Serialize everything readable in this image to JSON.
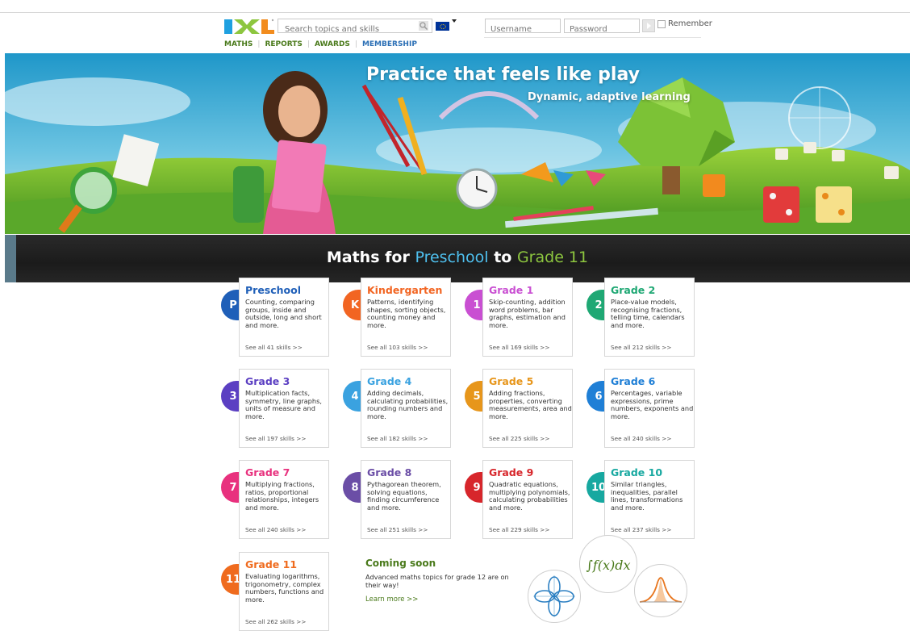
{
  "header": {
    "logo_text": "IXL",
    "search_placeholder": "Search topics and skills",
    "username_placeholder": "Username",
    "password_placeholder": "Password",
    "remember_label": "Remember",
    "nav": [
      {
        "label": "MATHS"
      },
      {
        "label": "REPORTS"
      },
      {
        "label": "AWARDS"
      },
      {
        "label": "MEMBERSHIP"
      }
    ]
  },
  "banner": {
    "title": "Practice that feels like play",
    "subtitle": "Dynamic, adaptive learning"
  },
  "strip": {
    "part1": "Maths for ",
    "preschool": "Preschool",
    "part2": " to ",
    "grade": "Grade 11"
  },
  "grades": [
    {
      "badge": "P",
      "name": "Preschool",
      "color": "#1f5fb8",
      "desc": "Counting, comparing groups, inside and outside, long and short and more.",
      "see": "See all 41 skills >>"
    },
    {
      "badge": "K",
      "name": "Kindergarten",
      "color": "#f26522",
      "desc": "Patterns, identifying shapes, sorting objects, counting money and more.",
      "see": "See all 103 skills >>"
    },
    {
      "badge": "1",
      "name": "Grade 1",
      "color": "#c94fd2",
      "desc": "Skip-counting, addition word problems, bar graphs, estimation and more.",
      "see": "See all 169 skills >>"
    },
    {
      "badge": "2",
      "name": "Grade 2",
      "color": "#1fa874",
      "desc": "Place-value models, recognising fractions, telling time, calendars and more.",
      "see": "See all 212 skills >>"
    },
    {
      "badge": "3",
      "name": "Grade 3",
      "color": "#5b3fc2",
      "desc": "Multiplication facts, symmetry, line graphs, units of measure and more.",
      "see": "See all 197 skills >>"
    },
    {
      "badge": "4",
      "name": "Grade 4",
      "color": "#3aa2e0",
      "desc": "Adding decimals, calculating probabilities, rounding numbers and more.",
      "see": "See all 182 skills >>"
    },
    {
      "badge": "5",
      "name": "Grade 5",
      "color": "#e7961b",
      "desc": "Adding fractions, properties, converting measurements, area and more.",
      "see": "See all 225 skills >>"
    },
    {
      "badge": "6",
      "name": "Grade 6",
      "color": "#1f7fd6",
      "desc": "Percentages, variable expressions, prime numbers, exponents and more.",
      "see": "See all 240 skills >>"
    },
    {
      "badge": "7",
      "name": "Grade 7",
      "color": "#e8317e",
      "desc": "Multiplying fractions, ratios, proportional relationships, integers and more.",
      "see": "See all 240 skills >>"
    },
    {
      "badge": "8",
      "name": "Grade 8",
      "color": "#6b4ea6",
      "desc": "Pythagorean theorem, solving equations, finding circumference and more.",
      "see": "See all 251 skills >>"
    },
    {
      "badge": "9",
      "name": "Grade 9",
      "color": "#d7262b",
      "desc": "Quadratic equations, multiplying polynomials, calculating probabilities and more.",
      "see": "See all 229 skills >>"
    },
    {
      "badge": "10",
      "name": "Grade 10",
      "color": "#17a8a0",
      "desc": "Similar triangles, inequalities, parallel lines, transformations and more.",
      "see": "See all 237 skills >>"
    },
    {
      "badge": "11",
      "name": "Grade 11",
      "color": "#ef6b1e",
      "desc": "Evaluating logarithms, trigonometry, complex numbers, functions and more.",
      "see": "See all 262 skills >>"
    }
  ],
  "coming_soon": {
    "title": "Coming soon",
    "desc": "Advanced maths topics for grade 12 are on their way!",
    "link": "Learn more >>",
    "formula": "∫f(x)dx"
  }
}
